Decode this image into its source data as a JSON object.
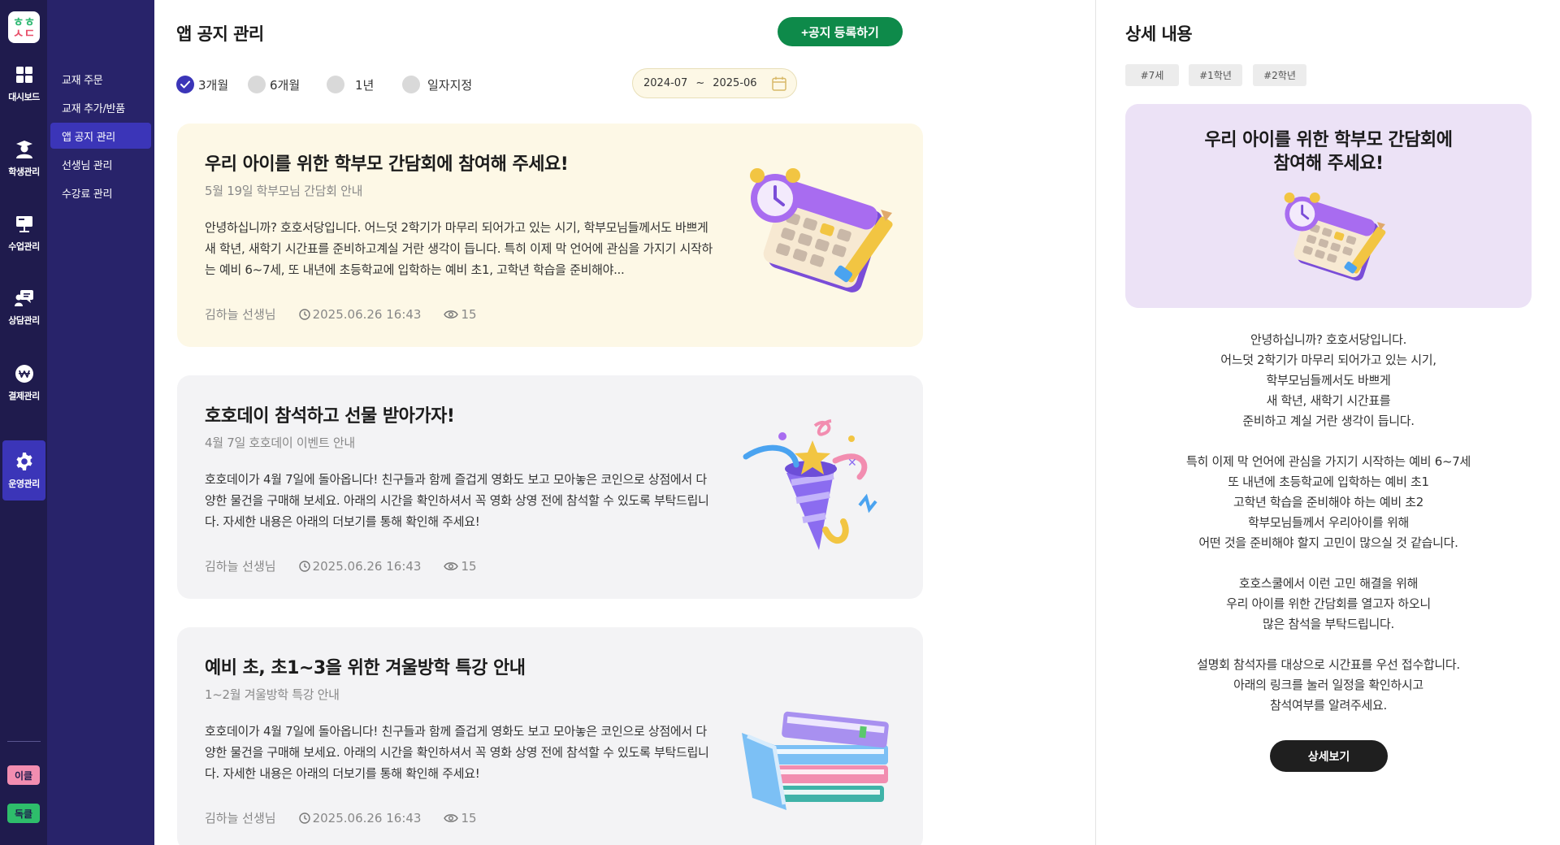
{
  "logo": {
    "line1": "ㅎㅎ",
    "line2": "ㅅㄷ"
  },
  "rail": {
    "items": [
      {
        "label": "대시보드",
        "icon": "dashboard-icon"
      },
      {
        "label": "학생관리",
        "icon": "student-icon"
      },
      {
        "label": "수업관리",
        "icon": "class-icon"
      },
      {
        "label": "상담관리",
        "icon": "counsel-icon"
      },
      {
        "label": "결제관리",
        "icon": "won-icon"
      },
      {
        "label": "운영관리",
        "icon": "gear-icon",
        "active": true
      }
    ],
    "brand_tags": [
      {
        "label": "이클",
        "bg": "#f28db0",
        "color": "#1f1b4d"
      },
      {
        "label": "독클",
        "bg": "#2ebd6b",
        "color": "#1f1b4d"
      }
    ]
  },
  "subnav": {
    "items": [
      {
        "label": "교재 주문"
      },
      {
        "label": "교재 추가/반품"
      },
      {
        "label": "앱 공지 관리",
        "active": true
      },
      {
        "label": "선생님 관리"
      },
      {
        "label": "수강료 관리"
      }
    ]
  },
  "main": {
    "title": "앱 공지 관리",
    "register_label": "+공지 등록하기",
    "filters": [
      {
        "label": "3개월",
        "checked": true
      },
      {
        "label": "6개월",
        "checked": false
      },
      {
        "label": "1년",
        "checked": false
      },
      {
        "label": "일자지정",
        "checked": false
      }
    ],
    "date_range": {
      "start": "2024-07",
      "sep": "~",
      "end": "2025-06"
    },
    "notices": [
      {
        "title": "우리 아이를 위한 학부모 간담회에 참여해 주세요!",
        "subtitle": "5월 19일 학부모님 간담회 안내",
        "body": "안녕하십니까? 호호서당입니다. 어느덧 2학기가 마무리 되어가고 있는 시기, 학부모님들께서도 바쁘게 새 학년, 새학기 시간표를 준비하고계실 거란 생각이 듭니다. 특히 이제 막 언어에 관심을 가지기 시작하는 예비 6~7세, 또 내년에 초등학교에 입학하는 예비 초1, 고학년 학습을 준비해야...",
        "author": "김하늘 선생님",
        "datetime": "2025.06.26 16:43",
        "views": "15",
        "illustration": "calendar-illustration",
        "bg": "#fdf8e6"
      },
      {
        "title": "호호데이 참석하고 선물 받아가자!",
        "subtitle": "4월 7일 호호데이 이벤트 안내",
        "body": "호호데이가 4월 7일에 돌아옵니다! 친구들과 함께 즐겁게 영화도 보고 모아놓은 코인으로 상점에서 다양한 물건을 구매해 보세요. 아래의 시간을 확인하셔서 꼭 영화 상영 전에 참석할 수 있도록 부탁드립니다. 자세한 내용은 아래의 더보기를 통해 확인해 주세요!",
        "author": "김하늘 선생님",
        "datetime": "2025.06.26 16:43",
        "views": "15",
        "illustration": "party-popper-illustration",
        "bg": "#f3f3f5"
      },
      {
        "title": "예비 초, 초1~3을 위한 겨울방학 특강 안내",
        "subtitle": "1~2월 겨울방학 특강 안내",
        "body": "호호데이가 4월 7일에 돌아옵니다! 친구들과 함께 즐겁게 영화도 보고 모아놓은 코인으로 상점에서 다양한 물건을 구매해 보세요. 아래의 시간을 확인하셔서 꼭 영화 상영 전에 참석할 수 있도록 부탁드립니다. 자세한 내용은 아래의 더보기를 통해 확인해 주세요!",
        "author": "김하늘 선생님",
        "datetime": "2025.06.26 16:43",
        "views": "15",
        "illustration": "books-illustration",
        "bg": "#f3f3f5"
      }
    ]
  },
  "detail": {
    "title": "상세 내용",
    "tags": [
      "#7세",
      "#1학년",
      "#2학년"
    ],
    "banner_title_line1": "우리 아이를 위한 학부모 간담회에",
    "banner_title_line2": "참여해 주세요!",
    "banner_bg": "#ece2f6",
    "body_paragraphs": [
      [
        "안녕하십니까? 호호서당입니다.",
        "어느덧 2학기가 마무리 되어가고 있는 시기,",
        "학부모님들께서도 바쁘게",
        "새 학년, 새학기 시간표를",
        "준비하고 계실 거란 생각이 듭니다."
      ],
      [
        "특히 이제 막 언어에 관심을 가지기 시작하는 예비 6~7세",
        "또 내년에 초등학교에 입학하는 예비 초1",
        "고학년 학습을 준비해야 하는 예비 초2",
        "학부모님들께서 우리아이를 위해",
        "어떤 것을 준비해야 할지 고민이 많으실 것 같습니다."
      ],
      [
        "호호스쿨에서 이런 고민 해결을 위해",
        "우리 아이를 위한 간담회를 열고자 하오니",
        "많은 참석을 부탁드립니다."
      ],
      [
        "설명회 참석자를 대상으로 시간표를 우선 접수합니다.",
        "아래의 링크를 눌러 일정을 확인하시고",
        "참석여부를 알려주세요."
      ]
    ],
    "detail_button_label": "상세보기"
  },
  "colors": {
    "rail_bg": "#1f1b4d",
    "subnav_bg": "#28236a",
    "active": "#3b35b8",
    "primary_button": "#0e8a4a"
  }
}
